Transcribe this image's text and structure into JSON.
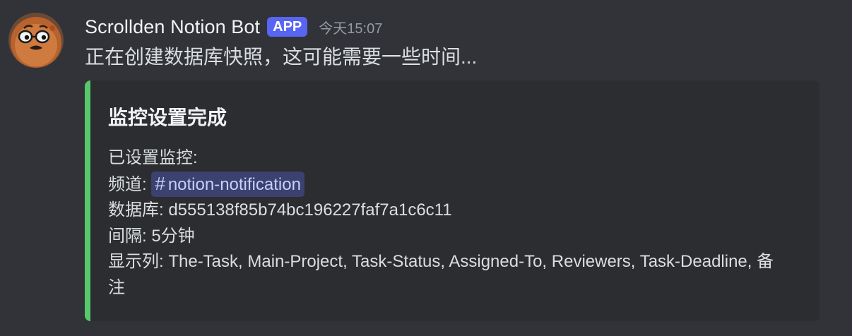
{
  "author": {
    "name": "Scrollden Notion Bot",
    "badge": "APP",
    "timestamp": "今天15:07",
    "avatar_icon": "cartoon-character-avatar-icon"
  },
  "message": {
    "text": "正在创建数据库快照，这可能需要一些时间..."
  },
  "embed": {
    "accent_color": "#57c76b",
    "title": "监控设置完成",
    "intro": "已设置监控:",
    "channel_label": "频道: ",
    "channel_hash": "#",
    "channel_name": "notion-notification",
    "database_line": "数据库: d555138f85b74bc196227faf7a1c6c11",
    "interval_line": "间隔: 5分钟",
    "columns_line": "显示列: The-Task, Main-Project, Task-Status, Assigned-To, Reviewers, Task-Deadline, 备注"
  },
  "colors": {
    "background": "#313338",
    "embed_background": "#2b2d31",
    "badge": "#5865f2",
    "mention_background": "#3c4270"
  }
}
